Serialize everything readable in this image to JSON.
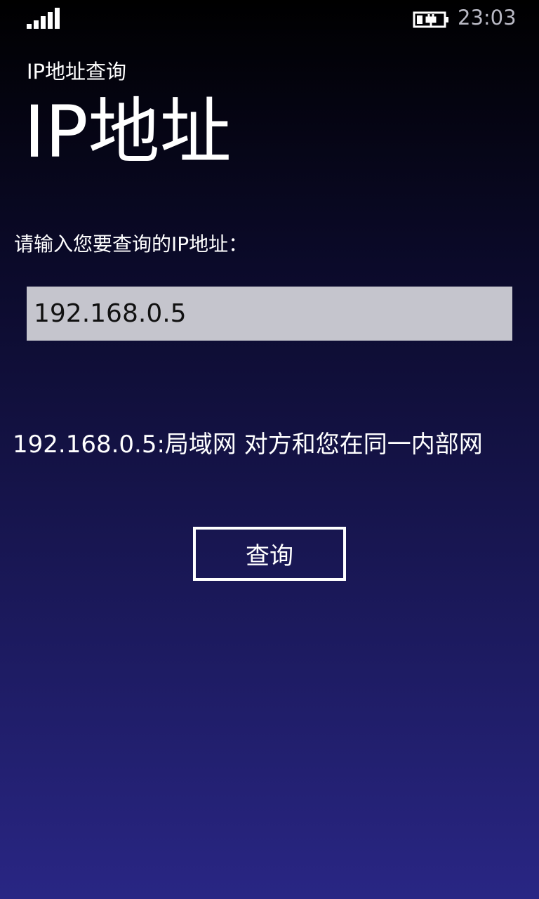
{
  "status_bar": {
    "signal_icon": "signal-strength-icon",
    "battery_icon": "battery-charging-icon",
    "time": "23:03"
  },
  "app": {
    "subtitle": "IP地址查询",
    "title": "IP地址"
  },
  "form": {
    "prompt": "请输入您要查询的IP地址：",
    "ip_value": "192.168.0.5",
    "result": "192.168.0.5:局域网 对方和您在同一内部网",
    "query_button_label": "查询"
  },
  "colors": {
    "input_background": "#c5c5cd",
    "background_top": "#000000",
    "background_bottom": "#292684"
  }
}
